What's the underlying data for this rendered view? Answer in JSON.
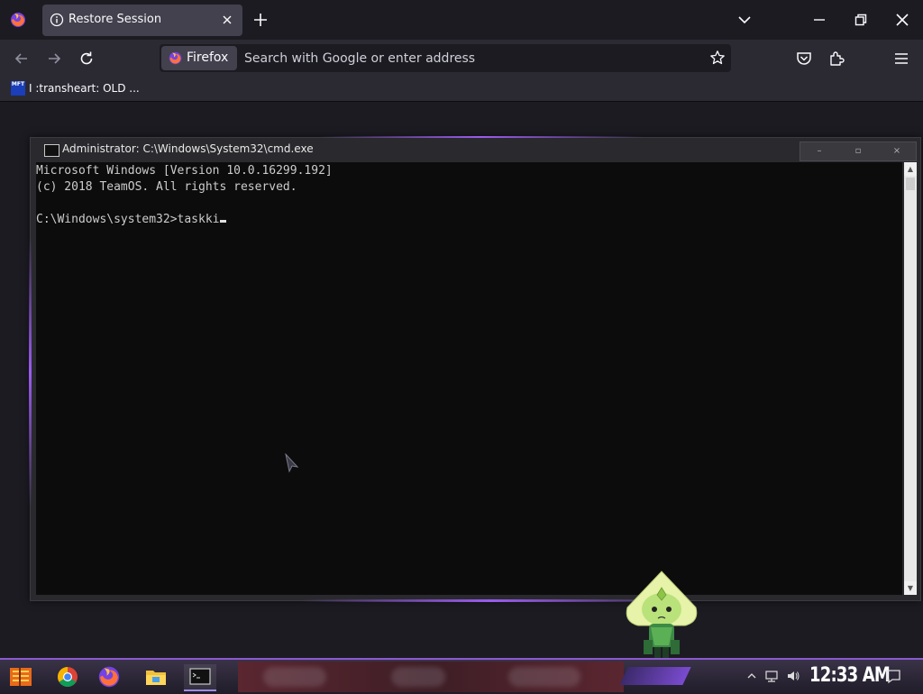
{
  "browser": {
    "tab": {
      "title": "Restore Session"
    },
    "identity_label": "Firefox",
    "url_placeholder": "Search with Google or enter address",
    "bookmark": {
      "favicon_text": "MFT",
      "label": "I :transheart: OLD ..."
    }
  },
  "cmd": {
    "title": "Administrator: C:\\Windows\\System32\\cmd.exe",
    "lines": [
      "Microsoft Windows [Version 10.0.16299.192]",
      "(c) 2018 TeamOS. All rights reserved.",
      "",
      "C:\\Windows\\system32>taskki"
    ],
    "controls": {
      "minimize": "–",
      "maximize": "▫",
      "close": "×"
    }
  },
  "taskbar": {
    "pinned": [
      "start-icon",
      "chrome-icon",
      "firefox-icon",
      "file-explorer-icon",
      "cmd-icon"
    ],
    "clock": "12:33 AM"
  },
  "colors": {
    "browser_bg": "#1c1b22",
    "toolbar_bg": "#2b2a33",
    "console_bg": "#0c0c0c",
    "console_text": "#cccccc",
    "accent_purple": "#9b5cf0"
  }
}
